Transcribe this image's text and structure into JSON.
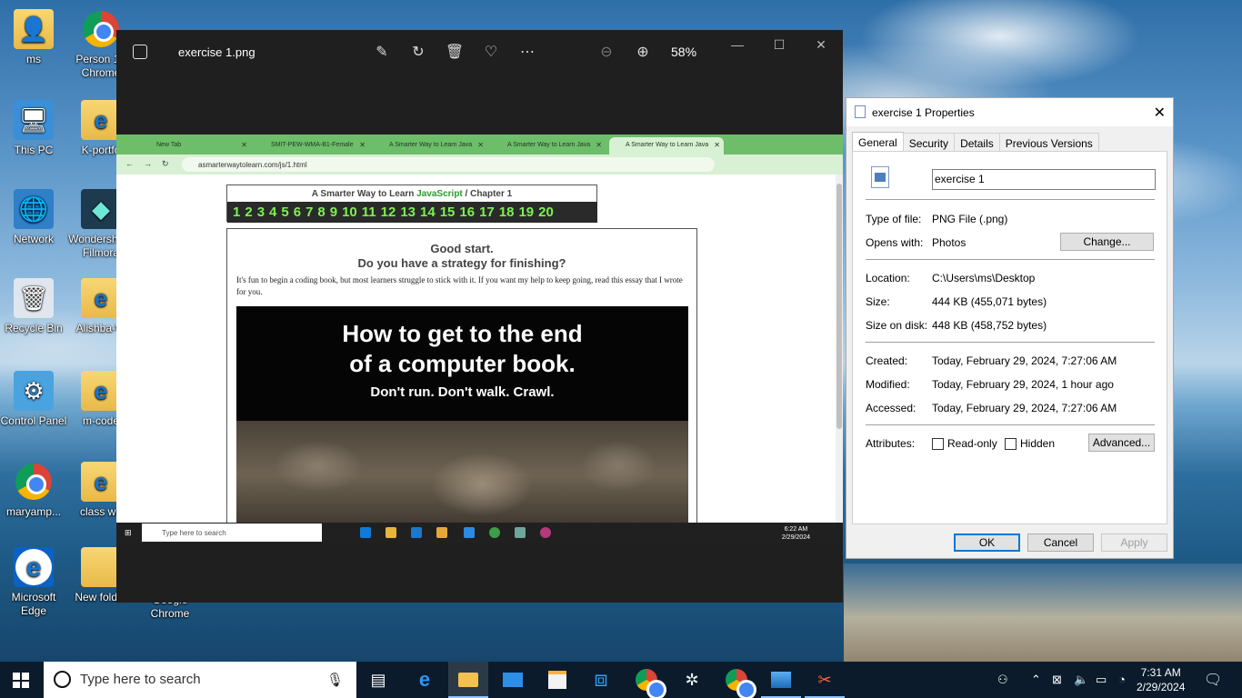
{
  "desktop": {
    "icons": [
      {
        "label": "ms"
      },
      {
        "label": "Person 1 - Chrome"
      },
      {
        "label": "This PC"
      },
      {
        "label": "K-portfo"
      },
      {
        "label": "Network"
      },
      {
        "label": "Wondershare Filmora"
      },
      {
        "label": "Recycle Bin"
      },
      {
        "label": "Alishba-W"
      },
      {
        "label": "Control Panel"
      },
      {
        "label": "m-code"
      },
      {
        "label": "maryamp..."
      },
      {
        "label": "class wo"
      },
      {
        "label": "Microsoft Edge"
      },
      {
        "label": "New folder"
      },
      {
        "label": "Google Chrome"
      }
    ]
  },
  "photos": {
    "title": "exercise 1.png",
    "zoom": "58%",
    "toolbar": [
      "edit-icon",
      "rotate-icon",
      "delete-icon",
      "favorite-icon",
      "more-icon",
      "zoom-out-icon",
      "zoom-in-icon"
    ]
  },
  "screenshot": {
    "tabs": [
      {
        "label": "New Tab"
      },
      {
        "label": "SMIT-PEW-WMA-B1-Female"
      },
      {
        "label": "A Smarter Way to Learn Java"
      },
      {
        "label": "A Smarter Way to Learn Java"
      },
      {
        "label": "A Smarter Way to Learn Java"
      }
    ],
    "url": "asmarterwaytolearn.com/js/1.html",
    "book_title_pre": "A Smarter Way to Learn",
    "book_title_js": "JavaScript",
    "book_title_post": "/  Chapter 1",
    "chapters": [
      "1",
      "2",
      "3",
      "4",
      "5",
      "6",
      "7",
      "8",
      "9",
      "10",
      "11",
      "12",
      "13",
      "14",
      "15",
      "16",
      "17",
      "18",
      "19",
      "20"
    ],
    "heading1": "Good start.",
    "heading2": "Do you have a strategy for finishing?",
    "paragraph": "It's fun to begin a coding book, but most learners struggle to stick with it. If you want my help to keep going, read this essay that I wrote for you.",
    "hero_line1": "How to get to the end",
    "hero_line2": "of a computer book.",
    "hero_line3": "Don't run. Don't walk. Crawl.",
    "search_placeholder": "Type here to search",
    "time": "6:22 AM",
    "date": "2/29/2024"
  },
  "properties": {
    "title": "exercise 1 Properties",
    "tabs": [
      "General",
      "Security",
      "Details",
      "Previous Versions"
    ],
    "file_name": "exercise 1",
    "type_label": "Type of file:",
    "type_value": "PNG File (.png)",
    "opens_label": "Opens with:",
    "opens_value": "Photos",
    "change_button": "Change...",
    "location_label": "Location:",
    "location_value": "C:\\Users\\ms\\Desktop",
    "size_label": "Size:",
    "size_value": "444 KB (455,071 bytes)",
    "disk_label": "Size on disk:",
    "disk_value": "448 KB (458,752 bytes)",
    "created_label": "Created:",
    "created_value": "Today, February 29, 2024, 7:27:06 AM",
    "modified_label": "Modified:",
    "modified_value": "Today, February 29, 2024, 1 hour ago",
    "accessed_label": "Accessed:",
    "accessed_value": "Today, February 29, 2024, 7:27:06 AM",
    "attributes_label": "Attributes:",
    "readonly_label": "Read-only",
    "hidden_label": "Hidden",
    "advanced_button": "Advanced...",
    "ok_button": "OK",
    "cancel_button": "Cancel",
    "apply_button": "Apply"
  },
  "taskbar": {
    "search_placeholder": "Type here to search",
    "time": "7:31 AM",
    "date": "2/29/2024",
    "apps": [
      "task-view-icon",
      "edge-icon",
      "file-explorer-icon",
      "mail-icon",
      "store-icon",
      "vscode-icon",
      "chrome-icon",
      "chatgpt-icon",
      "chrome-profile-icon",
      "photos-icon",
      "snipping-tool-icon"
    ]
  }
}
